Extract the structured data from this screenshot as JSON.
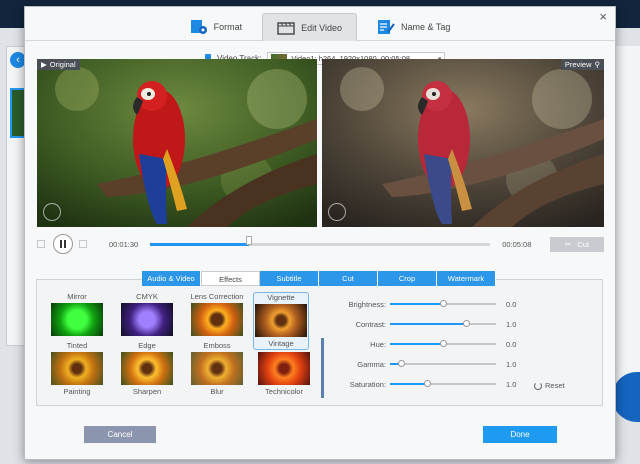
{
  "modal": {
    "tabs": [
      {
        "label": "Format",
        "icon": "format-icon",
        "active": false
      },
      {
        "label": "Edit Video",
        "icon": "edit-video-icon",
        "active": true
      },
      {
        "label": "Name & Tag",
        "icon": "name-tag-icon",
        "active": false
      }
    ],
    "close_label": "×"
  },
  "video_track": {
    "label": "Video Track:",
    "selected": "Video1: h264, 1920x1080, 00:05:08"
  },
  "preview": {
    "original_label": "Original",
    "preview_label": "Preview"
  },
  "playback": {
    "current_time": "00:01:30",
    "total_time": "00:05:08",
    "progress": 0.29,
    "cut_label": "Cut"
  },
  "sub_tabs": [
    "Audio & Video",
    "Effects",
    "Subtitle",
    "Cut",
    "Crop",
    "Watermark"
  ],
  "effects_top_labels": [
    "Mirror",
    "CMYK",
    "Lens Correction",
    "Vignette"
  ],
  "effects_mid_labels": [
    "Tinted",
    "Edge",
    "Emboss",
    "Vintage"
  ],
  "effects_bottom_labels": [
    "Painting",
    "Sharpen",
    "Blur",
    "Technicolor"
  ],
  "adjustments": [
    {
      "label": "Brightness:",
      "value": "0.0",
      "level": 0.5
    },
    {
      "label": "Contrast:",
      "value": "1.0",
      "level": 0.72
    },
    {
      "label": "Hue:",
      "value": "0.0",
      "level": 0.5
    },
    {
      "label": "Gamma:",
      "value": "1.0",
      "level": 0.1
    },
    {
      "label": "Saturation:",
      "value": "1.0",
      "level": 0.35
    }
  ],
  "reset_label": "Reset",
  "buttons": {
    "cancel": "Cancel",
    "done": "Done"
  },
  "colors": {
    "accent": "#2196f3",
    "done": "#1e9af0",
    "cancel": "#8b95ae"
  }
}
